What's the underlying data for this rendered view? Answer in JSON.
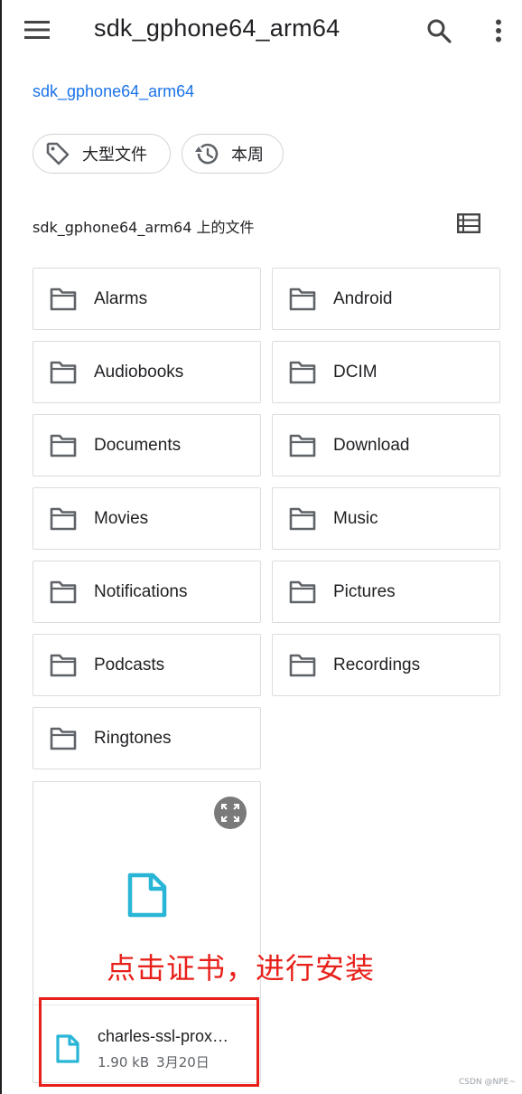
{
  "appbar": {
    "title": "sdk_gphone64_arm64",
    "icons": {
      "menu": "hamburger-menu-icon",
      "search": "search-icon",
      "more": "more-vertical-icon"
    }
  },
  "breadcrumb": {
    "label": "sdk_gphone64_arm64"
  },
  "chips": [
    {
      "label": "大型文件",
      "icon": "tag-icon"
    },
    {
      "label": "本周",
      "icon": "history-icon"
    }
  ],
  "section": {
    "title": "sdk_gphone64_arm64 上的文件",
    "view_icon": "list-view-icon"
  },
  "folders": [
    {
      "label": "Alarms"
    },
    {
      "label": "Android"
    },
    {
      "label": "Audiobooks"
    },
    {
      "label": "DCIM"
    },
    {
      "label": "Documents"
    },
    {
      "label": "Download"
    },
    {
      "label": "Movies"
    },
    {
      "label": "Music"
    },
    {
      "label": "Notifications"
    },
    {
      "label": "Pictures"
    },
    {
      "label": "Podcasts"
    },
    {
      "label": "Recordings"
    },
    {
      "label": "Ringtones"
    }
  ],
  "file": {
    "name": "charles-ssl-prox…",
    "size": "1.90 kB",
    "date": "3月20日",
    "icon": "document-icon",
    "expand_icon": "expand-icon"
  },
  "annotation": {
    "text": "点击证书，进行安装"
  },
  "watermark": "CSDN @NPE~",
  "colors": {
    "accent_blue": "#1a73e8",
    "file_icon_cyan": "#29b6d6",
    "annotation_red": "#e8201a",
    "icon_gray": "#5f6368",
    "tile_border": "#dadce0"
  }
}
